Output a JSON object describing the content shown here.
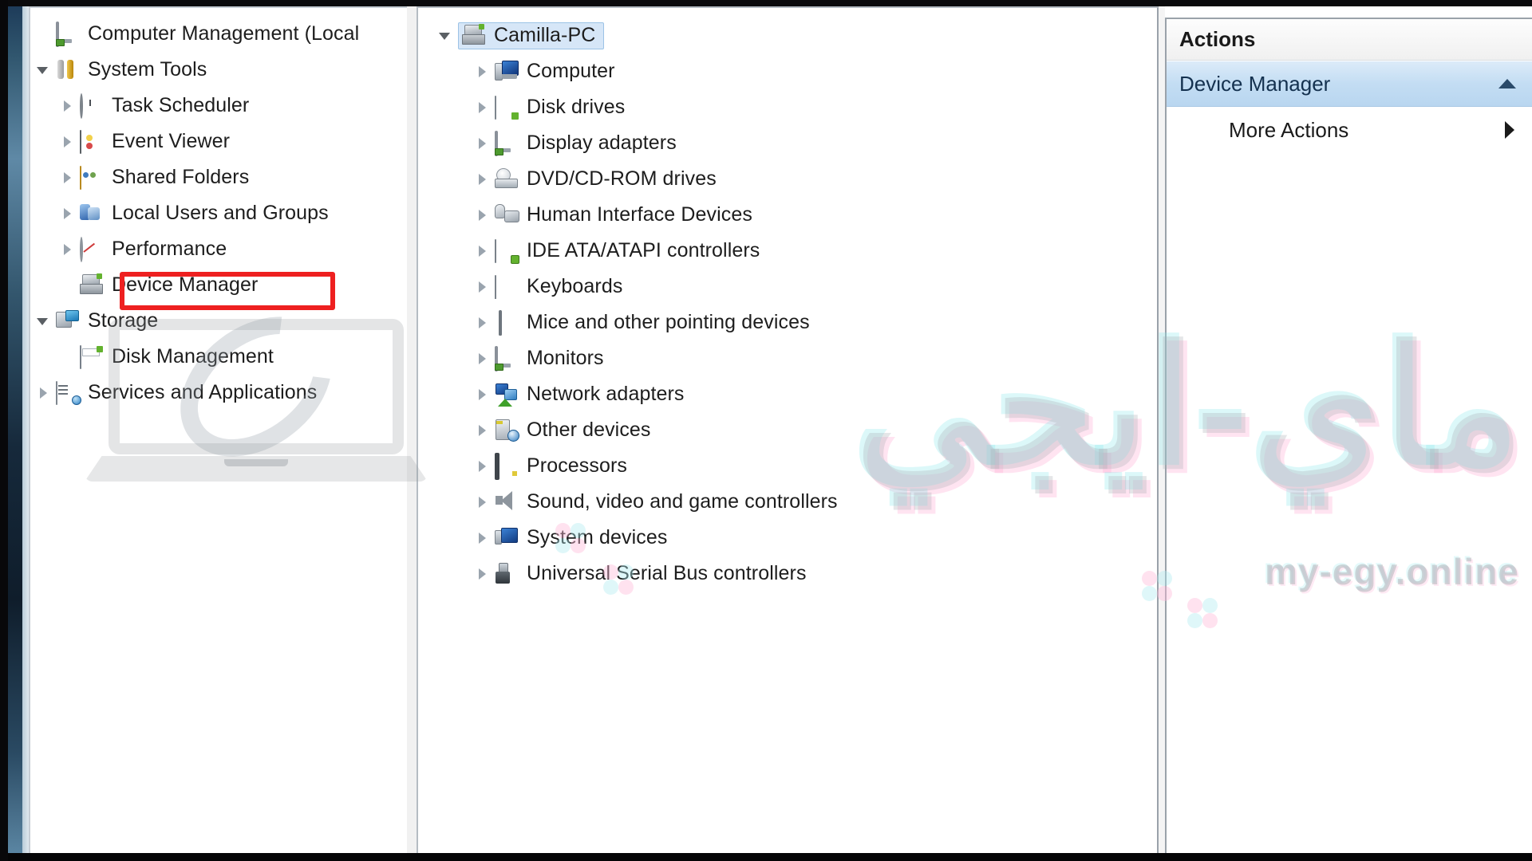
{
  "window": {
    "title": "Computer Management"
  },
  "left_tree": {
    "items": [
      {
        "label": "Computer Management (Local",
        "level": 0,
        "twisty": "none",
        "icon": "computer-management-icon"
      },
      {
        "label": "System Tools",
        "level": 0,
        "twisty": "expanded",
        "icon": "system-tools-icon"
      },
      {
        "label": "Task Scheduler",
        "level": 1,
        "twisty": "collapsed",
        "icon": "task-scheduler-icon"
      },
      {
        "label": "Event Viewer",
        "level": 1,
        "twisty": "collapsed",
        "icon": "event-viewer-icon"
      },
      {
        "label": "Shared Folders",
        "level": 1,
        "twisty": "collapsed",
        "icon": "shared-folders-icon"
      },
      {
        "label": "Local Users and Groups",
        "level": 1,
        "twisty": "collapsed",
        "icon": "local-users-icon"
      },
      {
        "label": "Performance",
        "level": 1,
        "twisty": "collapsed",
        "icon": "performance-icon"
      },
      {
        "label": "Device Manager",
        "level": 1,
        "twisty": "none",
        "icon": "device-manager-icon"
      },
      {
        "label": "Storage",
        "level": 0,
        "twisty": "expanded",
        "icon": "storage-icon"
      },
      {
        "label": "Disk Management",
        "level": 1,
        "twisty": "none",
        "icon": "disk-management-icon"
      },
      {
        "label": "Services and Applications",
        "level": 0,
        "twisty": "collapsed",
        "icon": "services-icon"
      }
    ],
    "highlight": {
      "label": "Device Manager",
      "color": "#ee2020"
    }
  },
  "device_tree": {
    "root": {
      "label": "Camilla-PC",
      "selected": true,
      "twisty": "expanded",
      "icon": "computer-node-icon"
    },
    "items": [
      {
        "label": "Computer",
        "icon": "computer-icon"
      },
      {
        "label": "Disk drives",
        "icon": "disk-drive-icon"
      },
      {
        "label": "Display adapters",
        "icon": "display-adapter-icon"
      },
      {
        "label": "DVD/CD-ROM drives",
        "icon": "dvd-drive-icon"
      },
      {
        "label": "Human Interface Devices",
        "icon": "hid-icon"
      },
      {
        "label": "IDE ATA/ATAPI controllers",
        "icon": "ide-controller-icon"
      },
      {
        "label": "Keyboards",
        "icon": "keyboard-icon"
      },
      {
        "label": "Mice and other pointing devices",
        "icon": "mouse-icon"
      },
      {
        "label": "Monitors",
        "icon": "monitor-icon"
      },
      {
        "label": "Network adapters",
        "icon": "network-adapter-icon"
      },
      {
        "label": "Other devices",
        "icon": "other-devices-icon"
      },
      {
        "label": "Processors",
        "icon": "processor-icon"
      },
      {
        "label": "Sound, video and game controllers",
        "icon": "sound-icon"
      },
      {
        "label": "System devices",
        "icon": "system-device-icon"
      },
      {
        "label": "Universal Serial Bus controllers",
        "icon": "usb-icon"
      }
    ]
  },
  "actions_panel": {
    "header": "Actions",
    "selected_item": {
      "label": "Device Manager",
      "chevron": "chevron-up-icon"
    },
    "items": [
      {
        "label": "More Actions",
        "chevron": "chevron-right-icon"
      }
    ]
  },
  "watermark": {
    "arabic": "ماي-ايجي",
    "site": "my-egy.online"
  }
}
